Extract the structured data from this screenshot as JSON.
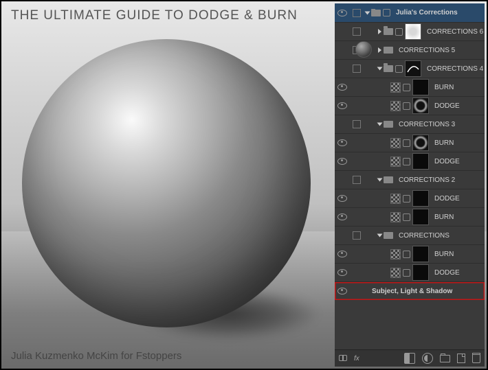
{
  "title": "THE ULTIMATE GUIDE TO DODGE & BURN",
  "credit": "Julia Kuzmenko McKim for Fstoppers",
  "layers": [
    {
      "vis": "eye",
      "gut": "box",
      "indent": 0,
      "kind": "group",
      "open": true,
      "hasLink": true,
      "thumb": null,
      "name": "Julia's Corrections",
      "bold": true,
      "sel": true
    },
    {
      "vis": "",
      "gut": "box",
      "indent": 18,
      "kind": "group",
      "open": false,
      "hasLink": true,
      "thumb": "w",
      "name": "CORRECTIONS 6"
    },
    {
      "vis": "",
      "gut": "box",
      "indent": 18,
      "kind": "group",
      "open": false,
      "name": "CORRECTIONS 5"
    },
    {
      "vis": "",
      "gut": "box",
      "indent": 18,
      "kind": "group",
      "open": true,
      "hasLink": true,
      "thumb": "c",
      "name": "CORRECTIONS 4"
    },
    {
      "vis": "eye",
      "gut": "",
      "indent": 36,
      "kind": "adj",
      "thumb": "sm",
      "name": "BURN"
    },
    {
      "vis": "eye",
      "gut": "",
      "indent": 36,
      "kind": "adj",
      "thumb": "ring",
      "name": "DODGE"
    },
    {
      "vis": "",
      "gut": "box",
      "indent": 18,
      "kind": "group",
      "open": true,
      "name": "CORRECTIONS 3"
    },
    {
      "vis": "eye",
      "gut": "",
      "indent": 36,
      "kind": "adj",
      "thumb": "ring",
      "name": "BURN"
    },
    {
      "vis": "eye",
      "gut": "",
      "indent": 36,
      "kind": "adj",
      "thumb": "sm",
      "name": "DODGE"
    },
    {
      "vis": "",
      "gut": "box",
      "indent": 18,
      "kind": "group",
      "open": true,
      "name": "CORRECTIONS 2"
    },
    {
      "vis": "eye",
      "gut": "",
      "indent": 36,
      "kind": "adj",
      "thumb": "sm",
      "name": "DODGE"
    },
    {
      "vis": "eye",
      "gut": "",
      "indent": 36,
      "kind": "adj",
      "thumb": "sm",
      "name": "BURN"
    },
    {
      "vis": "",
      "gut": "box",
      "indent": 18,
      "kind": "group",
      "open": true,
      "name": "CORRECTIONS"
    },
    {
      "vis": "eye",
      "gut": "",
      "indent": 36,
      "kind": "adj",
      "thumb": "sm",
      "name": "BURN"
    },
    {
      "vis": "eye",
      "gut": "",
      "indent": 36,
      "kind": "adj",
      "thumb": "sm",
      "name": "DODGE"
    },
    {
      "vis": "eye",
      "gut": "",
      "indent": 4,
      "kind": "layer",
      "thumb": "sphere",
      "name": "Subject, Light & Shadow",
      "bold": true,
      "hl": true
    }
  ],
  "footer_fx": "fx"
}
